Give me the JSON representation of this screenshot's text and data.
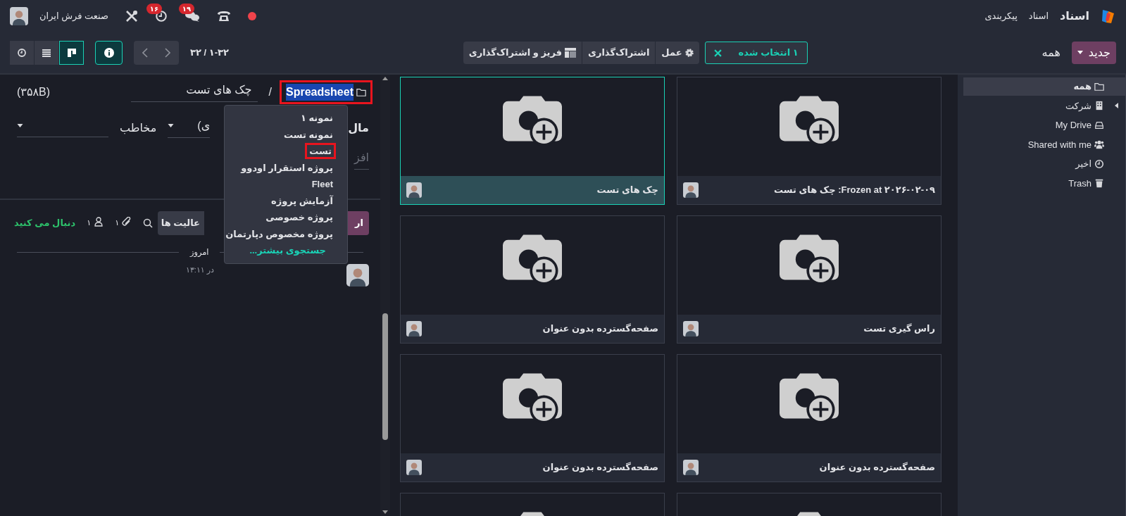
{
  "topbar": {
    "app_name": "اسناد",
    "menu": [
      "اسناد",
      "پیکربندی"
    ],
    "company": "صنعت فرش ایران",
    "chat_badge": "۱۹",
    "activity_badge": "۱۶"
  },
  "control_panel": {
    "new_button": "جدید",
    "breadcrumb": "همه",
    "selection": "۱ انتخاب شده",
    "actions": [
      {
        "label": "عمل",
        "kind": "gear"
      },
      {
        "label": "اشتراک‌گذاری",
        "kind": "plain"
      },
      {
        "label": "فریز و اشتراک‌گذاری",
        "kind": "freeze"
      }
    ],
    "pager": "۱-۳۲ / ۳۲",
    "info_button": {
      "selected": true
    },
    "views": [
      {
        "kind": "kanban",
        "selected": true
      },
      {
        "kind": "list",
        "selected": false
      },
      {
        "kind": "activity",
        "selected": false
      }
    ]
  },
  "sidebar": {
    "items": [
      {
        "label": "همه",
        "kind": "folder",
        "selected": true
      },
      {
        "label": "شرکت",
        "kind": "building",
        "selected": false,
        "expanded": false
      },
      {
        "label": "My Drive",
        "kind": "drive",
        "selected": false
      },
      {
        "label": "Shared with me",
        "kind": "users",
        "selected": false
      },
      {
        "label": "اخیر",
        "kind": "clock",
        "selected": false
      },
      {
        "label": "Trash",
        "kind": "trash",
        "selected": false
      }
    ]
  },
  "form": {
    "folder": {
      "label": "Spreadsheet",
      "highlighted": true
    },
    "separator": "/",
    "name": "چک های تست",
    "size": "(۳۵۸B)",
    "owner_label": "مال",
    "owner_value": "ی)",
    "contact_label": "مخاطب",
    "tags_placeholder": "افز"
  },
  "folder_menu": {
    "items": [
      {
        "label": "نمونه ۱",
        "kind": "folder",
        "highlighted": false
      },
      {
        "label": "نمونه تست",
        "kind": "folder",
        "highlighted": false
      },
      {
        "label": "تست",
        "kind": "folder",
        "highlighted": true
      },
      {
        "label": "پروژه استقرار اودوو",
        "kind": "folder",
        "highlighted": false
      },
      {
        "label": "Fleet",
        "kind": "folder",
        "highlighted": false
      },
      {
        "label": "آزمایش پروژه",
        "kind": "folder",
        "highlighted": false
      },
      {
        "label": "پروژه خصوصی",
        "kind": "folder",
        "highlighted": false
      },
      {
        "label": "پروژه مخصوص دپارتمان",
        "kind": "folder",
        "highlighted": false
      },
      {
        "label": "جستجوی بیشتر...",
        "kind": "search_more",
        "highlighted": false
      }
    ]
  },
  "chatter": {
    "send_button": "ار",
    "activities_button": "عالیت ها",
    "attachments": "۱",
    "followers": "۱",
    "follow_label": "دنبال می کنید",
    "date_separator": "امروز",
    "message_time": "در ۱۳:۱۱"
  },
  "cards": [
    {
      "title": "Frozen at ۲۰۲۶-۰۲-۰۹: چک های تست",
      "selected": false
    },
    {
      "title": "چک های تست",
      "selected": true
    },
    {
      "title": "راس گیری تست",
      "selected": false
    },
    {
      "title": "صفحه‌گسترده بدون عنوان",
      "selected": false
    },
    {
      "title": "صفحه‌گسترده بدون عنوان",
      "selected": false
    },
    {
      "title": "صفحه‌گسترده بدون عنوان",
      "selected": false
    },
    {
      "selected": false
    },
    {
      "selected": false
    }
  ]
}
